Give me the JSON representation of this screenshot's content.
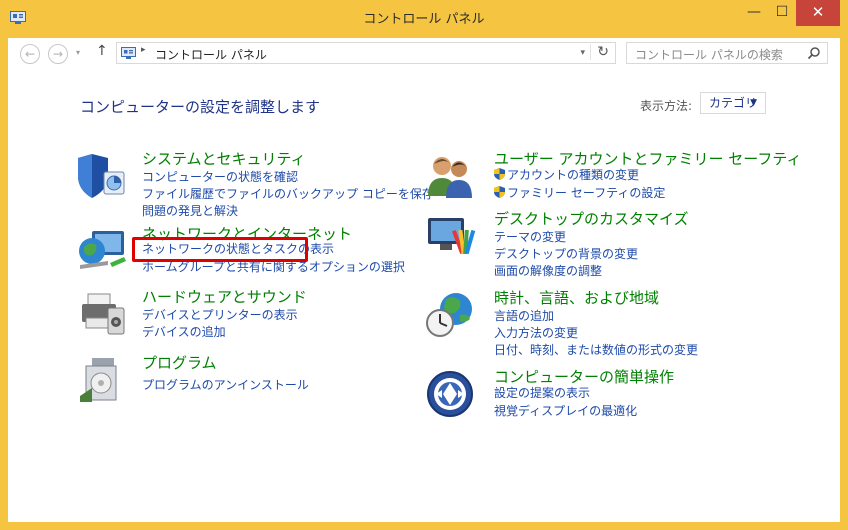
{
  "window": {
    "title": "コントロール パネル",
    "min_symbol": "—",
    "max_symbol": "☐",
    "close_symbol": "✕"
  },
  "nav": {
    "back_symbol": "←",
    "forward_symbol": "→",
    "recent_symbol": "▾",
    "up_symbol": "↑",
    "address_separator": "▸",
    "address": "コントロール パネル",
    "address_dropdown_symbol": "▾",
    "refresh_symbol": "↻",
    "search_placeholder": "コントロール パネルの検索"
  },
  "main": {
    "heading": "コンピューターの設定を調整します",
    "view_by_label": "表示方法:",
    "view_by_value": "カテゴリ",
    "view_by_caret": "▼"
  },
  "categories": {
    "system": {
      "title": "システムとセキュリティ",
      "links": [
        "コンピューターの状態を確認",
        "ファイル履歴でファイルのバックアップ コピーを保存",
        "問題の発見と解決"
      ]
    },
    "network": {
      "title": "ネットワークとインターネット",
      "links": [
        "ネットワークの状態とタスクの表示",
        "ホームグループと共有に関するオプションの選択"
      ]
    },
    "hardware": {
      "title": "ハードウェアとサウンド",
      "links": [
        "デバイスとプリンターの表示",
        "デバイスの追加"
      ]
    },
    "programs": {
      "title": "プログラム",
      "links": [
        "プログラムのアンインストール"
      ]
    },
    "users": {
      "title": "ユーザー アカウントとファミリー セーフティ",
      "links": [
        "アカウントの種類の変更",
        "ファミリー セーフティの設定"
      ]
    },
    "appearance": {
      "title": "デスクトップのカスタマイズ",
      "links": [
        "テーマの変更",
        "デスクトップの背景の変更",
        "画面の解像度の調整"
      ]
    },
    "clock": {
      "title": "時計、言語、および地域",
      "links": [
        "言語の追加",
        "入力方法の変更",
        "日付、時刻、または数値の形式の変更"
      ]
    },
    "ease": {
      "title": "コンピューターの簡単操作",
      "links": [
        "設定の提案の表示",
        "視覚ディスプレイの最適化"
      ]
    }
  },
  "colors": {
    "title_bar": "#f5c542",
    "category_title": "#008000",
    "link": "#1e4aa8",
    "heading": "#1e3287",
    "highlight": "#e00000"
  }
}
